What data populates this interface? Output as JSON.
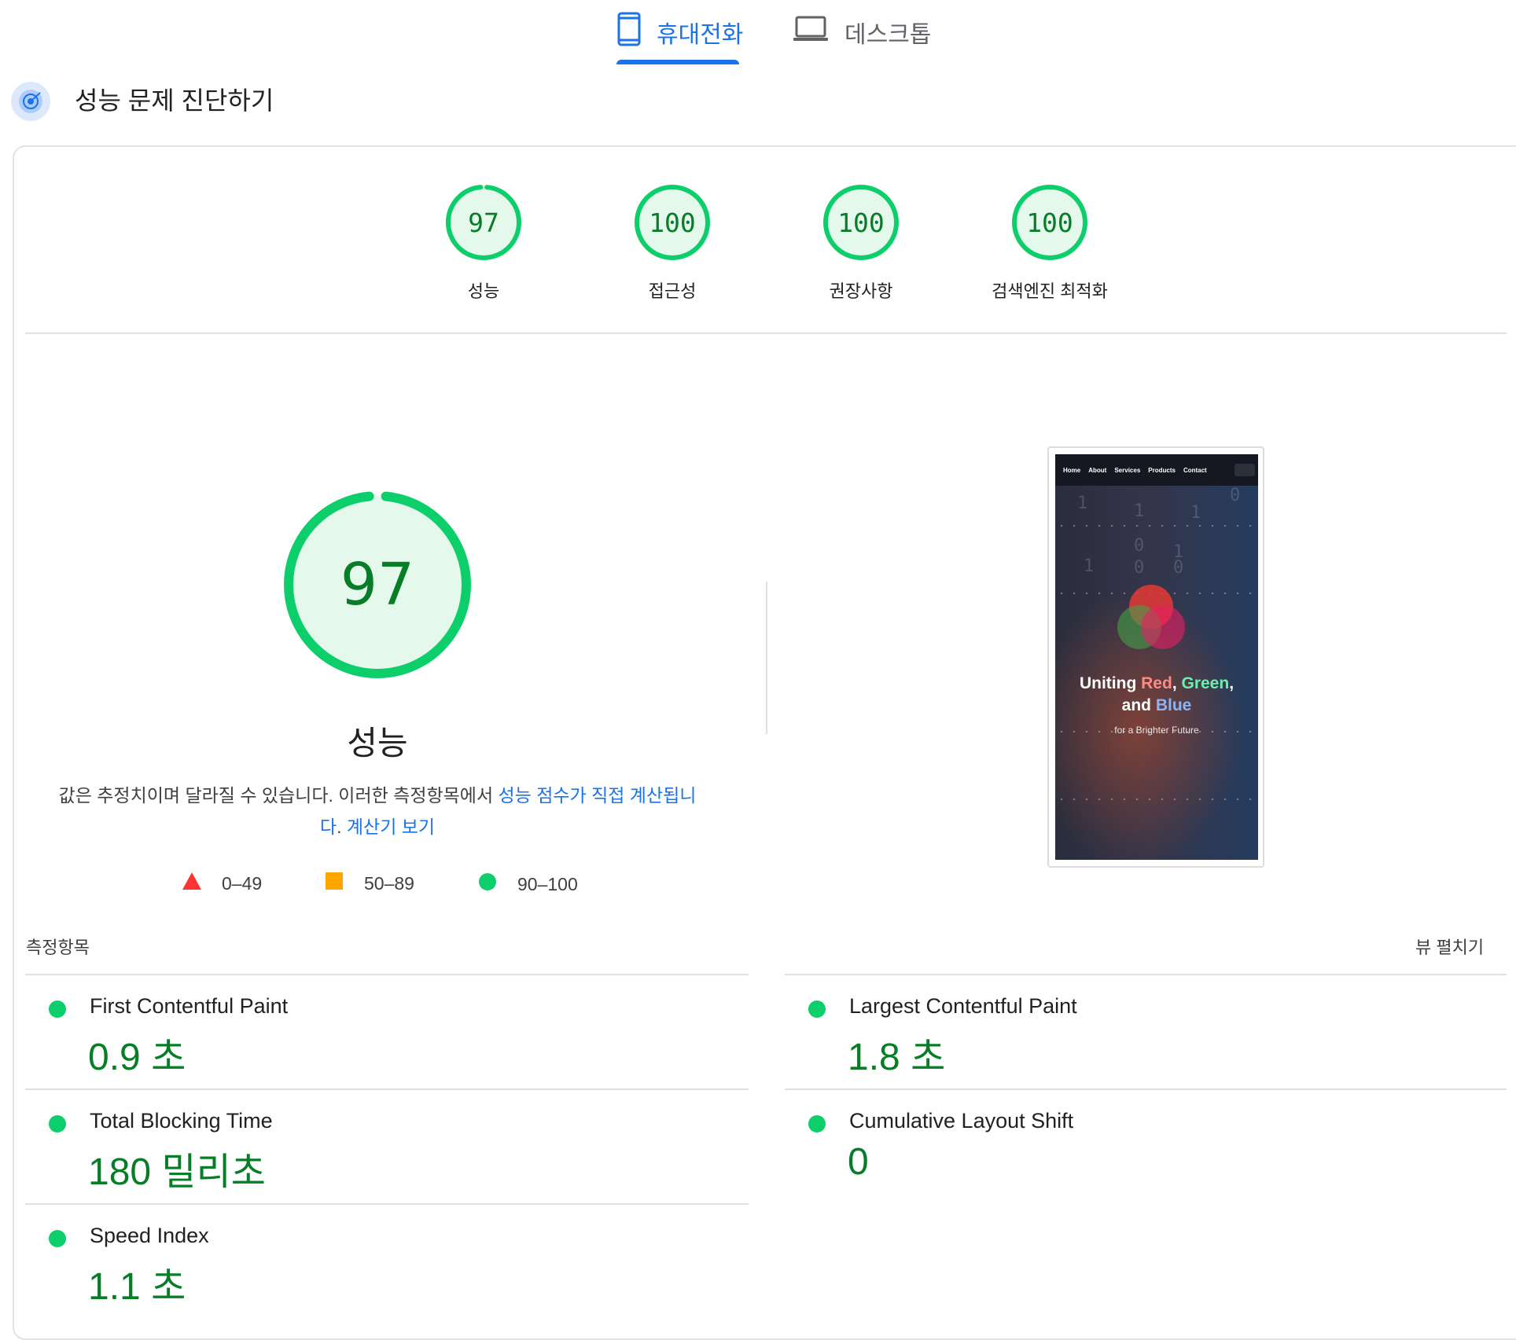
{
  "tabs": {
    "mobile_label": "휴대전화",
    "desktop_label": "데스크톱",
    "active": "mobile"
  },
  "header": {
    "title": "성능 문제 진단하기"
  },
  "summary_scores": [
    {
      "score": "97",
      "label": "성능"
    },
    {
      "score": "100",
      "label": "접근성"
    },
    {
      "score": "100",
      "label": "권장사항"
    },
    {
      "score": "100",
      "label": "검색엔진 최적화"
    }
  ],
  "performance": {
    "score": "97",
    "score_fraction": 0.97,
    "title": "성능",
    "description_text": "값은 추정치이며 달라질 수 있습니다. 이러한 측정항목에서 ",
    "description_link": "성능 점수가 직접 계산됩니다",
    "description_end": ".",
    "calculator_link": "계산기 보기"
  },
  "legend": [
    {
      "range": "0–49",
      "shape": "triangle",
      "color": "#ff3333"
    },
    {
      "range": "50–89",
      "shape": "square",
      "color": "#ffa400"
    },
    {
      "range": "90–100",
      "shape": "circle",
      "color": "#0cce6b"
    }
  ],
  "screenshot": {
    "nav": [
      "Home",
      "About",
      "Services",
      "Products",
      "Contact"
    ],
    "hero_prefix": "Uniting ",
    "hero_red": "Red",
    "hero_sep1": ", ",
    "hero_green": "Green",
    "hero_sep2": ",",
    "hero_and": "and ",
    "hero_blue": "Blue",
    "hero_sub": "for a Brighter Future"
  },
  "metrics": {
    "section_label": "측정항목",
    "expand_label": "뷰 펼치기",
    "items": [
      {
        "name": "First Contentful Paint",
        "value": "0.9 초",
        "status": "good"
      },
      {
        "name": "Largest Contentful Paint",
        "value": "1.8 초",
        "status": "good"
      },
      {
        "name": "Total Blocking Time",
        "value": "180 밀리초",
        "status": "good"
      },
      {
        "name": "Cumulative Layout Shift",
        "value": "0",
        "status": "good"
      },
      {
        "name": "Speed Index",
        "value": "1.1 초",
        "status": "good"
      }
    ]
  },
  "colors": {
    "accent": "#1a73e8",
    "pass": "#0cce6b",
    "pass_text": "#087d27",
    "pass_bg": "#e5f8ec"
  }
}
